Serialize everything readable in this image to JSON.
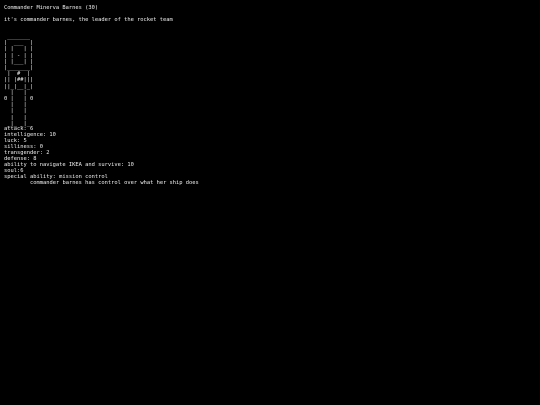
{
  "header": {
    "title": "Commander Minerva Barnes (30)",
    "description": "it's commander barnes, the leader of the rocket team"
  },
  "character": {
    "portrait_icon": "ascii-astronaut-icon",
    "ascii_art": " _______\n|  ___  |\n| |   | |\n| | - | |\n| |___| |\n|_______|\n |  #  |\n|| |##|||\n||_|__|_|\n  |   |\n0 |   | 0\n  |   |\n  |   |\n  |   |\n _|_ _|_"
  },
  "stats": {
    "attack": "attack: 6",
    "intelligence": "intelligence: 10",
    "luck": "luck: 5",
    "silliness": "silliness: 0",
    "transgender": "transgender: 2",
    "defense": "defense: 8",
    "ikea": "ability to navigate IKEA and survive: 10",
    "soul": "soul:6",
    "special_ability": "special ability: mission control",
    "special_description": "commander barnes has control over what her ship does"
  }
}
